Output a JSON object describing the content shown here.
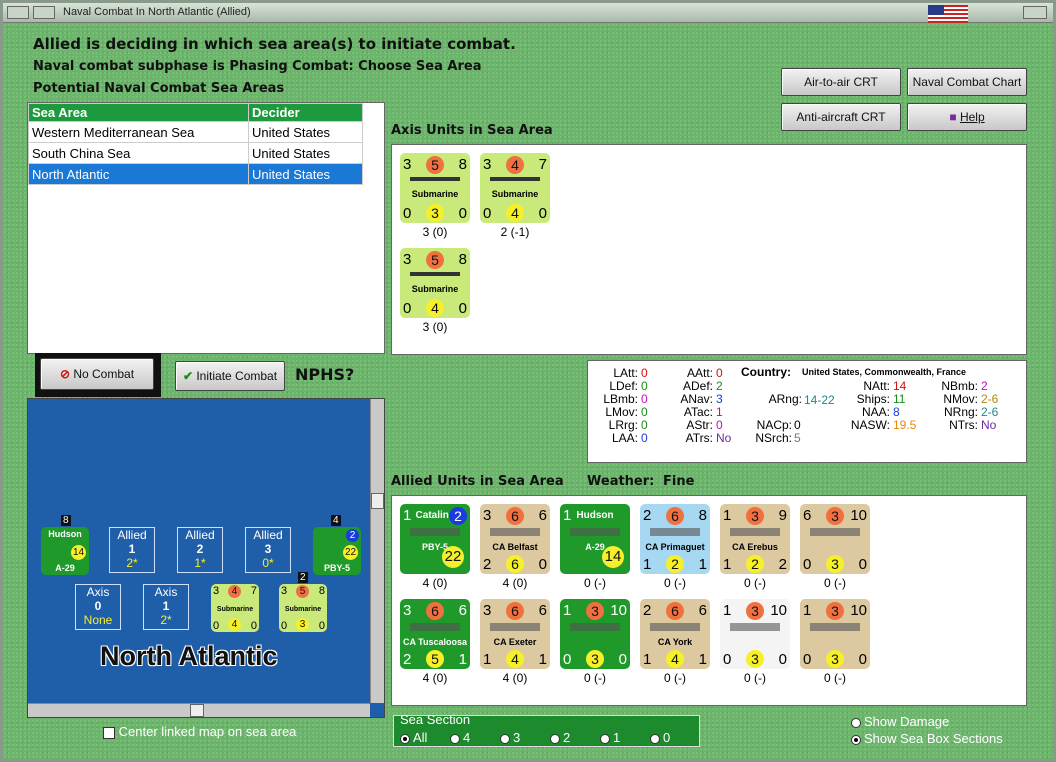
{
  "window": {
    "title": "Naval Combat In North Atlantic (Allied)"
  },
  "header": {
    "line1": "Allied is deciding in which sea area(s) to initiate combat.",
    "line2": "Naval combat subphase is Phasing Combat: Choose Sea Area",
    "line3": "Potential Naval Combat Sea Areas"
  },
  "sea_table": {
    "columns": [
      "Sea Area",
      "Decider"
    ],
    "rows": [
      [
        "Western Mediterranean Sea",
        "United States"
      ],
      [
        "South China Sea",
        "United States"
      ],
      [
        "North Atlantic",
        "United States"
      ]
    ],
    "selected_index": 2
  },
  "buttons": {
    "air_to_air": "Air-to-air CRT",
    "naval_chart": "Naval Combat Chart",
    "anti_aircraft": "Anti-aircraft CRT",
    "help": "Help",
    "no_combat": "No Combat",
    "initiate": "Initiate Combat"
  },
  "nphs": "NPHS?",
  "axis_section": {
    "title": "Axis Units in Sea Area",
    "units": [
      {
        "tl": "3",
        "tc": "5",
        "tr": "8",
        "name": "Submarine",
        "bl": "0",
        "bc": "3",
        "br": "0",
        "below": "3 (0)"
      },
      {
        "tl": "3",
        "tc": "4",
        "tr": "7",
        "name": "Submarine",
        "bl": "0",
        "bc": "4",
        "br": "0",
        "below": "2 (-1)"
      },
      {
        "tl": "3",
        "tc": "5",
        "tr": "8",
        "name": "Submarine",
        "bl": "0",
        "bc": "4",
        "br": "0",
        "below": "3 (0)"
      }
    ]
  },
  "stats": {
    "LAtt": "0",
    "LDef": "0",
    "LBmb": "0",
    "LMov": "0",
    "LRrg": "0",
    "LAA": "0",
    "AAtt": "0",
    "ADef": "2",
    "ANav": "3",
    "ATac": "1",
    "AStr": "0",
    "ATrs": "No",
    "country_label": "Country:",
    "country": "United States, Commonwealth, France",
    "ARng": "14-22",
    "NACp": "0",
    "NSrch": "5",
    "NAtt": "14",
    "Ships": "11",
    "NAA": "8",
    "NASW": "19.5",
    "NBmb": "2",
    "NMov": "2-6",
    "NRng": "2-6",
    "NTrs": "No"
  },
  "allied_section": {
    "title": "Allied Units in Sea Area",
    "weather_label": "Weather:",
    "weather": "Fine",
    "units": [
      {
        "tl": "1",
        "tc": "Catalina",
        "tr": "2",
        "name": "PBY-5",
        "bl": "",
        "bc": "22",
        "br": "",
        "below": "4 (0)",
        "style": "green"
      },
      {
        "tl": "3",
        "tc": "6",
        "tr": "6",
        "name": "CA Belfast",
        "bl": "2",
        "bc": "6",
        "br": "0",
        "below": "4 (0)",
        "style": "tan"
      },
      {
        "tl": "1",
        "tc": "Hudson",
        "tr": "",
        "name": "A-29",
        "bl": "",
        "bc": "14",
        "br": "",
        "below": "0 (-)",
        "style": "green"
      },
      {
        "tl": "2",
        "tc": "6",
        "tr": "8",
        "name": "CA Primaguet",
        "bl": "1",
        "bc": "2",
        "br": "1",
        "below": "0 (-)",
        "style": "blue"
      },
      {
        "tl": "1",
        "tc": "3",
        "tr": "9",
        "name": "CA Erebus",
        "bl": "1",
        "bc": "2",
        "br": "2",
        "below": "0 (-)",
        "style": "tan"
      },
      {
        "tl": "6",
        "tc": "3",
        "tr": "10",
        "name": "",
        "bl": "0",
        "bc": "3",
        "br": "0",
        "below": "0 (-)",
        "style": "tan"
      },
      {
        "tl": "3",
        "tc": "6",
        "tr": "6",
        "name": "CA Tuscaloosa",
        "bl": "2",
        "bc": "5",
        "br": "1",
        "below": "4 (0)",
        "style": "green"
      },
      {
        "tl": "3",
        "tc": "6",
        "tr": "6",
        "name": "CA Exeter",
        "bl": "1",
        "bc": "4",
        "br": "1",
        "below": "4 (0)",
        "style": "tan"
      },
      {
        "tl": "1",
        "tc": "3",
        "tr": "10",
        "name": "",
        "bl": "0",
        "bc": "3",
        "br": "0",
        "below": "0 (-)",
        "style": "green"
      },
      {
        "tl": "2",
        "tc": "6",
        "tr": "6",
        "name": "CA York",
        "bl": "1",
        "bc": "4",
        "br": "1",
        "below": "0 (-)",
        "style": "tan"
      },
      {
        "tl": "1",
        "tc": "3",
        "tr": "10",
        "name": "",
        "bl": "0",
        "bc": "3",
        "br": "0",
        "below": "0 (-)",
        "style": "white"
      },
      {
        "tl": "1",
        "tc": "3",
        "tr": "10",
        "name": "",
        "bl": "0",
        "bc": "3",
        "br": "0",
        "below": "0 (-)",
        "style": "tan"
      }
    ]
  },
  "map": {
    "label": "North Atlantic",
    "allied_boxes": [
      {
        "title": "Allied",
        "num": "1",
        "val": "2*"
      },
      {
        "title": "Allied",
        "num": "2",
        "val": "1*"
      },
      {
        "title": "Allied",
        "num": "3",
        "val": "0*"
      }
    ],
    "axis_boxes": [
      {
        "title": "Axis",
        "num": "0",
        "val": "None"
      },
      {
        "title": "Axis",
        "num": "1",
        "val": "2*"
      }
    ],
    "counter_hudson": {
      "name": "Hudson",
      "type": "A-29",
      "val": "14",
      "stack": "8"
    },
    "counter_pby": {
      "name": "Catalina",
      "type": "PBY-5",
      "val": "22",
      "stack": "4",
      "top": "2"
    },
    "map_sub1": {
      "tl": "3",
      "tc": "4",
      "tr": "7",
      "name": "Submarine",
      "bl": "0",
      "bc": "4",
      "br": "0"
    },
    "map_sub2": {
      "tl": "3",
      "tc": "5",
      "tr": "8",
      "name": "Submarine",
      "bl": "0",
      "bc": "3",
      "br": "0",
      "stack": "2"
    }
  },
  "center_map": "Center linked map on sea area",
  "sea_section": {
    "label": "Sea Section",
    "options": [
      "All",
      "4",
      "3",
      "2",
      "1",
      "0"
    ],
    "selected": 0
  },
  "show_damage": "Show Damage",
  "show_sections": "Show Sea Box Sections"
}
